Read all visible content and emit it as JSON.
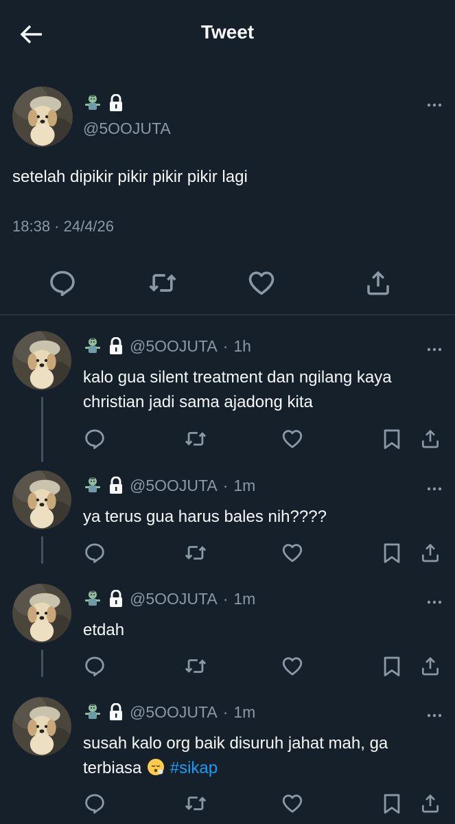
{
  "header": {
    "title": "Tweet",
    "back_icon": "arrow-left-icon"
  },
  "colors": {
    "background": "#15202b",
    "text": "#f7f9f9",
    "secondary": "#8b98a5",
    "link": "#1d9bf0",
    "divider": "#38444d"
  },
  "main_tweet": {
    "name_icons": [
      "zombie-emoji",
      "lock-icon"
    ],
    "handle": "@5OOJUTA",
    "text": "setelah dipikir pikir pikir pikir lagi",
    "timestamp": "18:38 · 24/4/26",
    "actions": [
      "reply-icon",
      "retweet-icon",
      "like-icon",
      "share-icon"
    ]
  },
  "replies": [
    {
      "handle": "@5OOJUTA",
      "sep": "·",
      "time": "1h",
      "text": "kalo gua silent treatment dan ngilang kaya christian jadi sama ajadong kita"
    },
    {
      "handle": "@5OOJUTA",
      "sep": "·",
      "time": "1m",
      "text": "ya terus gua harus bales nih????"
    },
    {
      "handle": "@5OOJUTA",
      "sep": "·",
      "time": "1m",
      "text": "etdah"
    },
    {
      "handle": "@5OOJUTA",
      "sep": "·",
      "time": "1m",
      "text": "susah kalo org baik disuruh jahat mah, ga terbiasa",
      "emoji": "face-exhaling-emoji",
      "hashtag": "#sikap"
    }
  ]
}
